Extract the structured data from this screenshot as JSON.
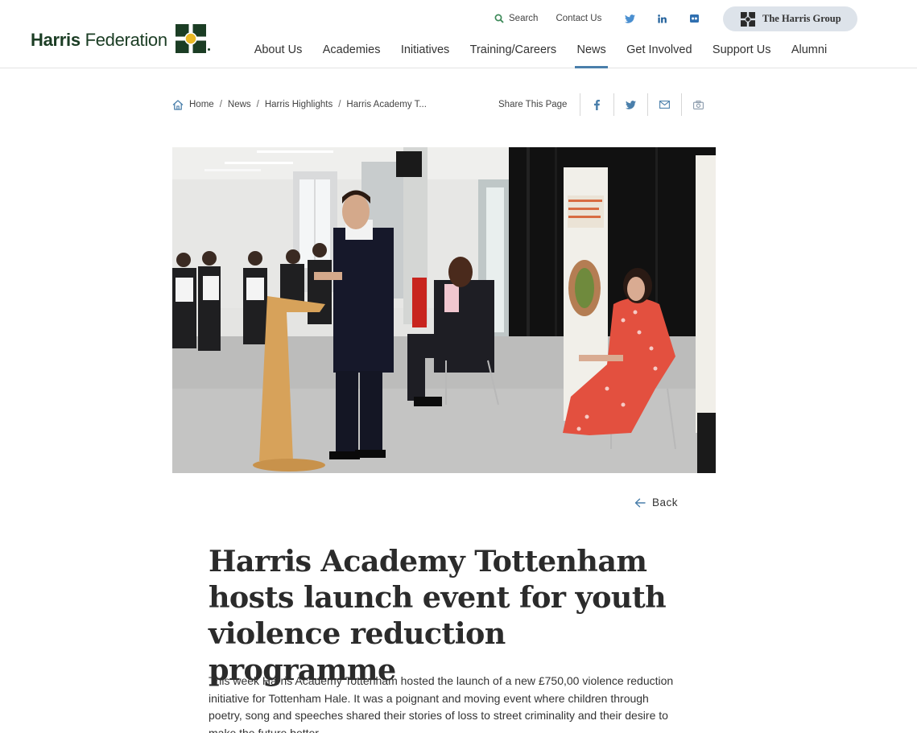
{
  "header": {
    "logo": {
      "name_bold": "Harris",
      "name_regular": " Federation"
    },
    "utility": {
      "search_label": "Search",
      "contact_label": "Contact Us",
      "social": [
        "twitter-icon",
        "linkedin-icon",
        "flickr-icon"
      ],
      "group_label": "The Harris Group"
    },
    "nav": [
      {
        "label": "About Us"
      },
      {
        "label": "Academies"
      },
      {
        "label": "Initiatives"
      },
      {
        "label": "Training/Careers"
      },
      {
        "label": "News",
        "active": true
      },
      {
        "label": "Get Involved"
      },
      {
        "label": "Support Us"
      },
      {
        "label": "Alumni"
      }
    ]
  },
  "breadcrumb": {
    "items": [
      "Home",
      "News",
      "Harris Highlights",
      "Harris Academy T..."
    ]
  },
  "share": {
    "label": "Share This Page",
    "buttons": [
      "facebook-icon",
      "twitter-icon",
      "email-icon",
      "camera-icon"
    ]
  },
  "article": {
    "back_label": "Back",
    "title": "Harris Academy Tottenham hosts launch event for youth violence reduction programme",
    "body": "This week Harris Academy Tottenham hosted the launch of a new £750,00 violence reduction initiative for Tottenham Hale. It was a poignant and moving event where children through poetry, song and speeches shared their stories of loss to street criminality and their desire to make the future better."
  },
  "colors": {
    "brand_green": "#1b3d24",
    "logo_gold": "#e9b824",
    "accent_blue": "#4a7fab",
    "pill_bg": "#dde3ea"
  }
}
